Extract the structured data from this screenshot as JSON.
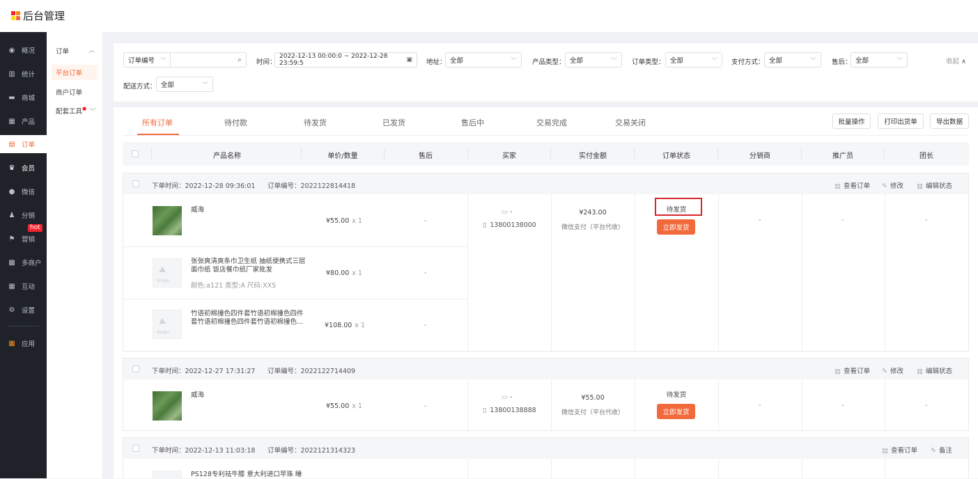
{
  "app": {
    "title": "后台管理",
    "logo_colors": [
      "#f5222d",
      "#fa8c16",
      "#fadb14",
      "#f26a3b"
    ]
  },
  "sidebar": {
    "items": [
      {
        "label": "概况",
        "icon": "dashboard-icon"
      },
      {
        "label": "统计",
        "icon": "stats-icon"
      },
      {
        "label": "商城",
        "icon": "store-icon"
      },
      {
        "label": "产品",
        "icon": "product-icon"
      },
      {
        "label": "订单",
        "icon": "order-icon"
      },
      {
        "label": "会员",
        "icon": "crown-icon"
      },
      {
        "label": "微信",
        "icon": "wechat-icon"
      },
      {
        "label": "分销",
        "icon": "distribution-icon"
      },
      {
        "label": "营销",
        "icon": "flag-icon",
        "badge": "hot"
      },
      {
        "label": "多商户",
        "icon": "merchant-icon"
      },
      {
        "label": "互动",
        "icon": "interact-icon"
      },
      {
        "label": "设置",
        "icon": "gear-icon"
      },
      {
        "label": "应用",
        "icon": "apps-icon"
      }
    ]
  },
  "submenu": {
    "title": "订单",
    "items": [
      "平台订单",
      "商户订单",
      "配套工具"
    ]
  },
  "filters": {
    "order_no_select": "订单编号",
    "time_label": "时间：",
    "time_value": "2022-12-13 00:00:0 ~ 2022-12-28 23:59:5",
    "address_label": "地址：",
    "product_type_label": "产品类型：",
    "order_type_label": "订单类型：",
    "pay_label": "支付方式：",
    "after_sale_label": "售后：",
    "delivery_label": "配送方式：",
    "all": "全部",
    "collapse": "收起"
  },
  "tabs": [
    "所有订单",
    "待付款",
    "待发货",
    "已发货",
    "售后中",
    "交易完成",
    "交易关闭"
  ],
  "actions": {
    "batch": "批量操作",
    "print": "打印出货单",
    "export": "导出数据"
  },
  "columns": [
    "产品名称",
    "单价/数量",
    "售后",
    "买家",
    "实付金额",
    "订单状态",
    "分销商",
    "推广员",
    "团长"
  ],
  "labels": {
    "order_time": "下单时间：",
    "order_no": "订单编号：",
    "view": "查看订单",
    "edit": "修改",
    "edit_status": "编辑状态",
    "remark": "备注",
    "ship_now": "立即发货",
    "no_image": "暂无图片"
  },
  "orders": [
    {
      "time": "2022-12-28 09:36:01",
      "no": "2022122814418",
      "products": [
        {
          "name": "威海",
          "price": "¥55.00",
          "qty": "x 1",
          "after": "-"
        },
        {
          "name": "张张爽清爽条巾卫生纸 抽纸便携式三层面巾纸 饭店餐巾纸厂家批发",
          "meta": "颜色:a121 类型:A 尺码:XXS",
          "price": "¥80.00",
          "qty": "x 1",
          "after": "-"
        },
        {
          "name": "竹语初棉撞色四件套竹语初棉撞色四件套竹语初棉撞色四件套竹语初棉撞色...",
          "price": "¥108.00",
          "qty": "x 1",
          "after": "-"
        }
      ],
      "buyer_name": "-",
      "buyer_phone": "13800138000",
      "amount": "¥243.00",
      "pay": "微信支付（平台代收）",
      "status": "待发货",
      "dist": "-",
      "promoter": "-",
      "leader": "-"
    },
    {
      "time": "2022-12-27 17:31:27",
      "no": "2022122714409",
      "products": [
        {
          "name": "威海",
          "price": "¥55.00",
          "qty": "x 1",
          "after": "-"
        }
      ],
      "buyer_name": "-",
      "buyer_phone": "13800138888",
      "amount": "¥55.00",
      "pay": "微信支付（平台代收）",
      "status": "待发货",
      "dist": "-",
      "promoter": "-",
      "leader": "-"
    },
    {
      "time": "2022-12-13 11:03:18",
      "no": "2022121314323",
      "products": [
        {
          "name": "PS128专利祛牛膝 意大利进口苹珠 睡"
        }
      ]
    }
  ]
}
